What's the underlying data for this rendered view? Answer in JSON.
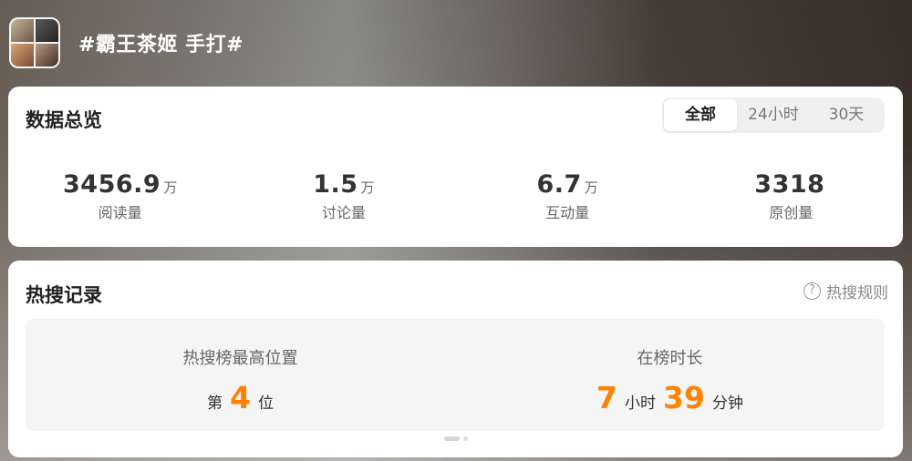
{
  "header": {
    "topic_title": "#霸王茶姬 手打#"
  },
  "overview": {
    "title": "数据总览",
    "tabs": [
      {
        "label": "全部",
        "active": true
      },
      {
        "label": "24小时",
        "active": false
      },
      {
        "label": "30天",
        "active": false
      }
    ],
    "stats": [
      {
        "value": "3456.9",
        "unit": "万",
        "label": "阅读量"
      },
      {
        "value": "1.5",
        "unit": "万",
        "label": "讨论量"
      },
      {
        "value": "6.7",
        "unit": "万",
        "label": "互动量"
      },
      {
        "value": "3318",
        "unit": "",
        "label": "原创量"
      }
    ]
  },
  "hot_search": {
    "title": "热搜记录",
    "rules_label": "热搜规则",
    "rules_icon": "question-circle-icon",
    "peak": {
      "label": "热搜榜最高位置",
      "prefix": "第",
      "rank": "4",
      "suffix": "位"
    },
    "duration": {
      "label": "在榜时长",
      "hours": "7",
      "hours_unit": "小时",
      "minutes": "39",
      "minutes_unit": "分钟"
    },
    "pager": {
      "pages": 2,
      "current": 1
    }
  },
  "colors": {
    "accent_orange": "#ff8200",
    "card_bg": "#ffffff",
    "panel_bg": "#f5f5f5"
  }
}
